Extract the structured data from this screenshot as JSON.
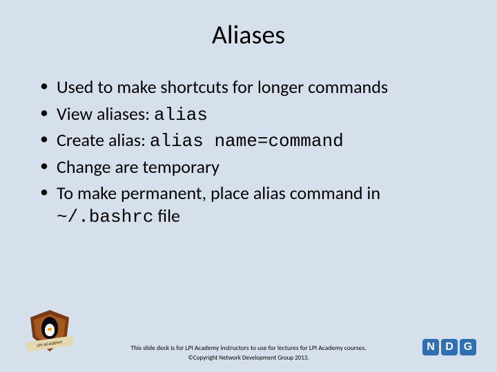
{
  "title": "Aliases",
  "bullets": [
    {
      "pre": "Used to make shortcuts for longer commands",
      "code": "",
      "post": ""
    },
    {
      "pre": "View aliases: ",
      "code": "alias",
      "post": ""
    },
    {
      "pre": "Create alias: ",
      "code": "alias name=command",
      "post": ""
    },
    {
      "pre": "Change are temporary",
      "code": "",
      "post": ""
    },
    {
      "pre": "To make permanent, place alias command in ",
      "code": "~/.bashrc",
      "post": " file"
    }
  ],
  "footer": {
    "line1": "This slide deck is for LPI Academy instructors to use for lectures for LPI Academy courses.",
    "line2": "©Copyright Network Development Group 2013."
  },
  "badge": {
    "banner_text": "LPI ACADEMY"
  },
  "ndg": {
    "n": "N",
    "d": "D",
    "g": "G"
  }
}
